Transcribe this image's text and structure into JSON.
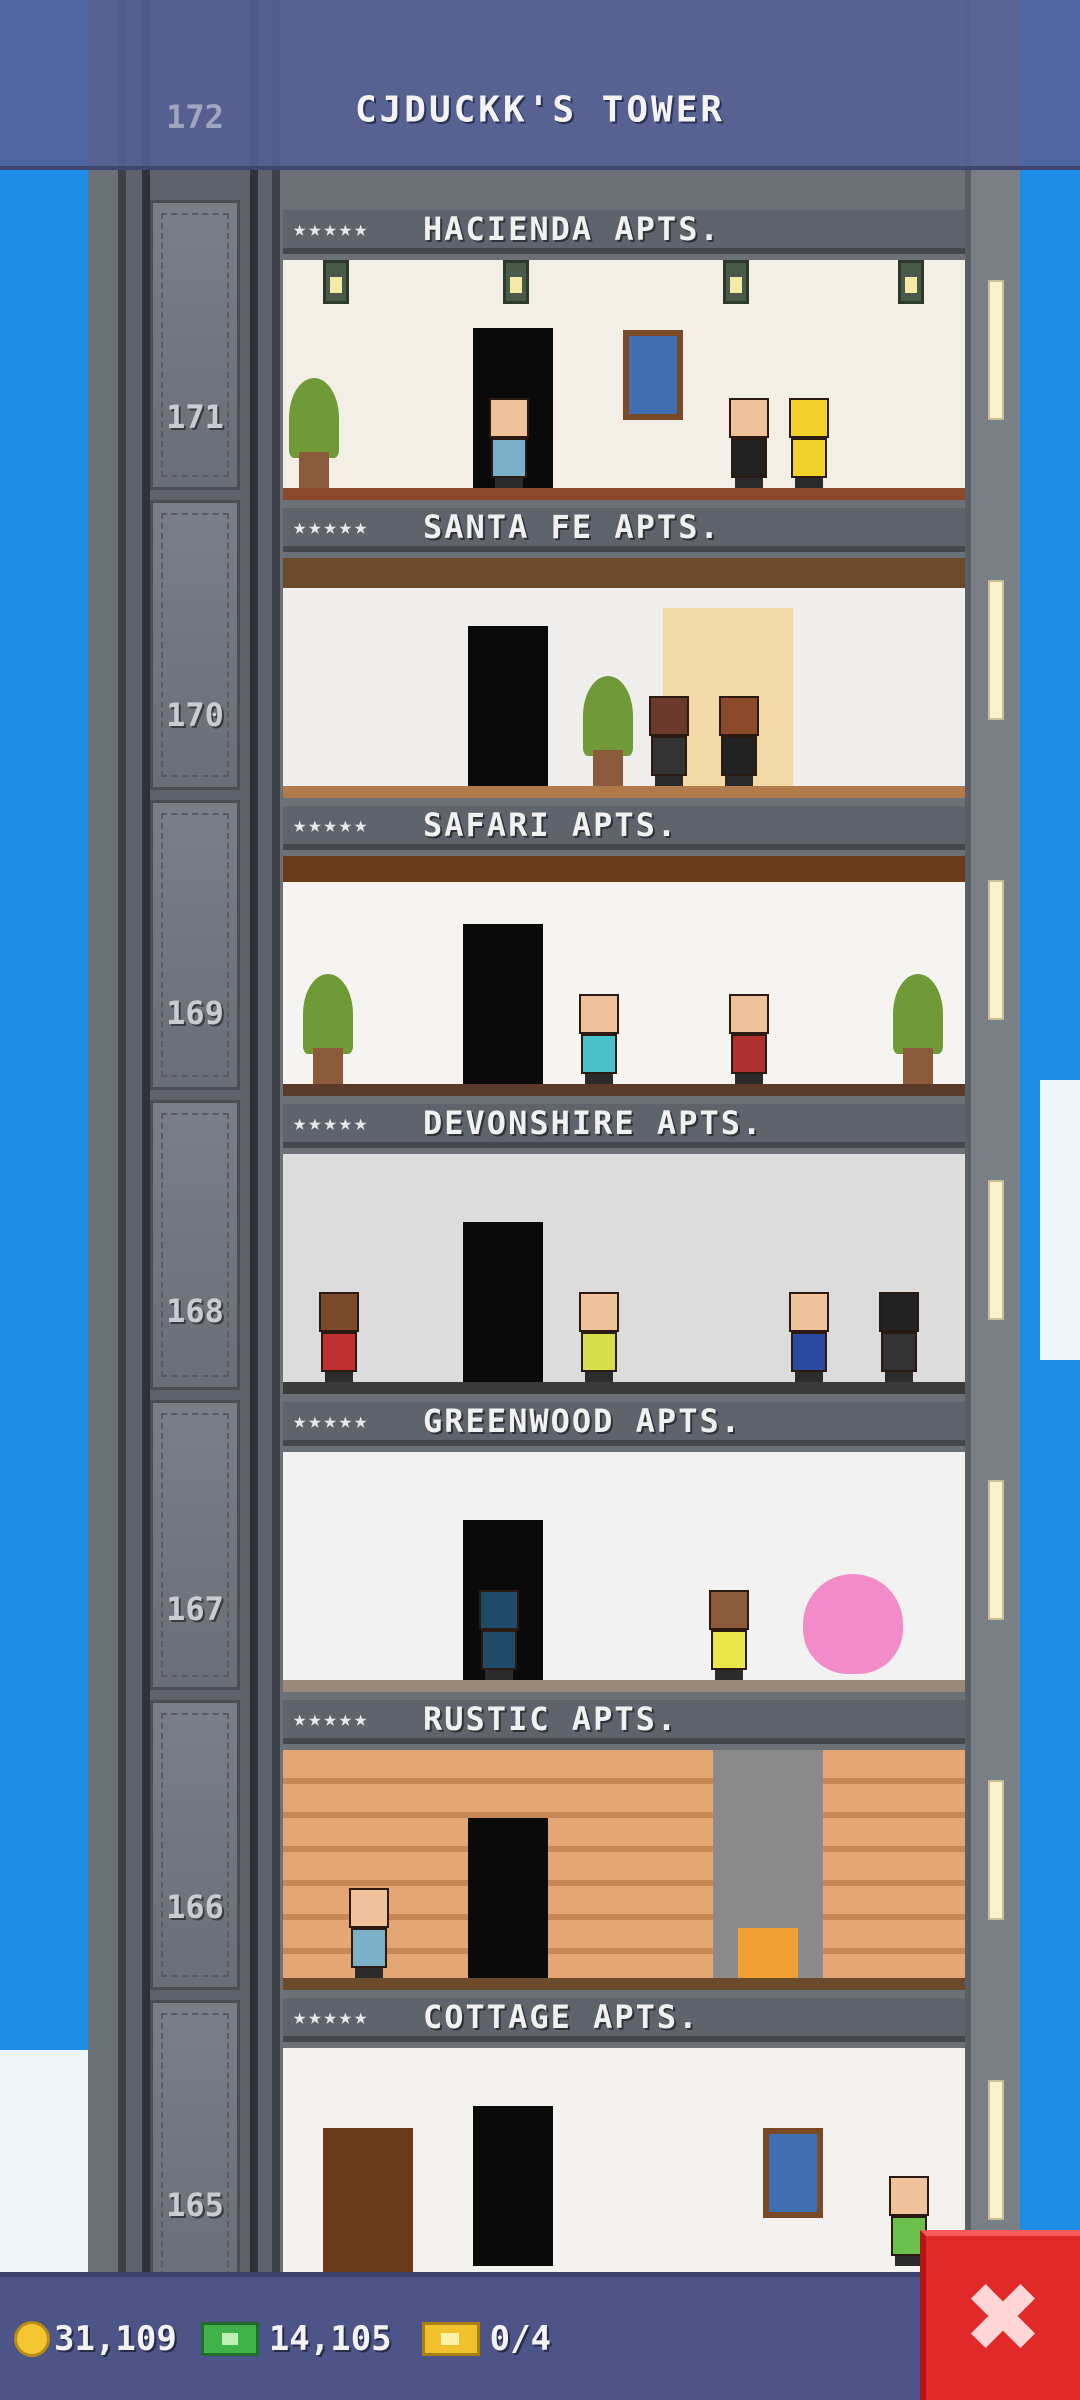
{
  "header": {
    "tower_title": "CJDUCKK'S TOWER",
    "top_floor_number": "172"
  },
  "floors": [
    {
      "number": "171",
      "stars": "★★★★★",
      "name": "HACIENDA APTS."
    },
    {
      "number": "170",
      "stars": "★★★★★",
      "name": "SANTA FE APTS."
    },
    {
      "number": "169",
      "stars": "★★★★★",
      "name": "SAFARI APTS."
    },
    {
      "number": "168",
      "stars": "★★★★★",
      "name": "DEVONSHIRE APTS."
    },
    {
      "number": "167",
      "stars": "★★★★★",
      "name": "GREENWOOD APTS."
    },
    {
      "number": "166",
      "stars": "★★★★★",
      "name": "RUSTIC APTS."
    },
    {
      "number": "165",
      "stars": "★★★★★",
      "name": "COTTAGE APTS."
    }
  ],
  "stats": {
    "coins": "31,109",
    "bux": "14,105",
    "tickets": "0/4"
  },
  "icons": {
    "coin": "coin-icon",
    "bux": "bux-icon",
    "ticket": "ticket-icon",
    "close": "close-icon"
  },
  "colors": {
    "sky": "#1e8de8",
    "hud": "#4c5488",
    "close_button": "#e02a2a"
  },
  "close_label": "✖"
}
